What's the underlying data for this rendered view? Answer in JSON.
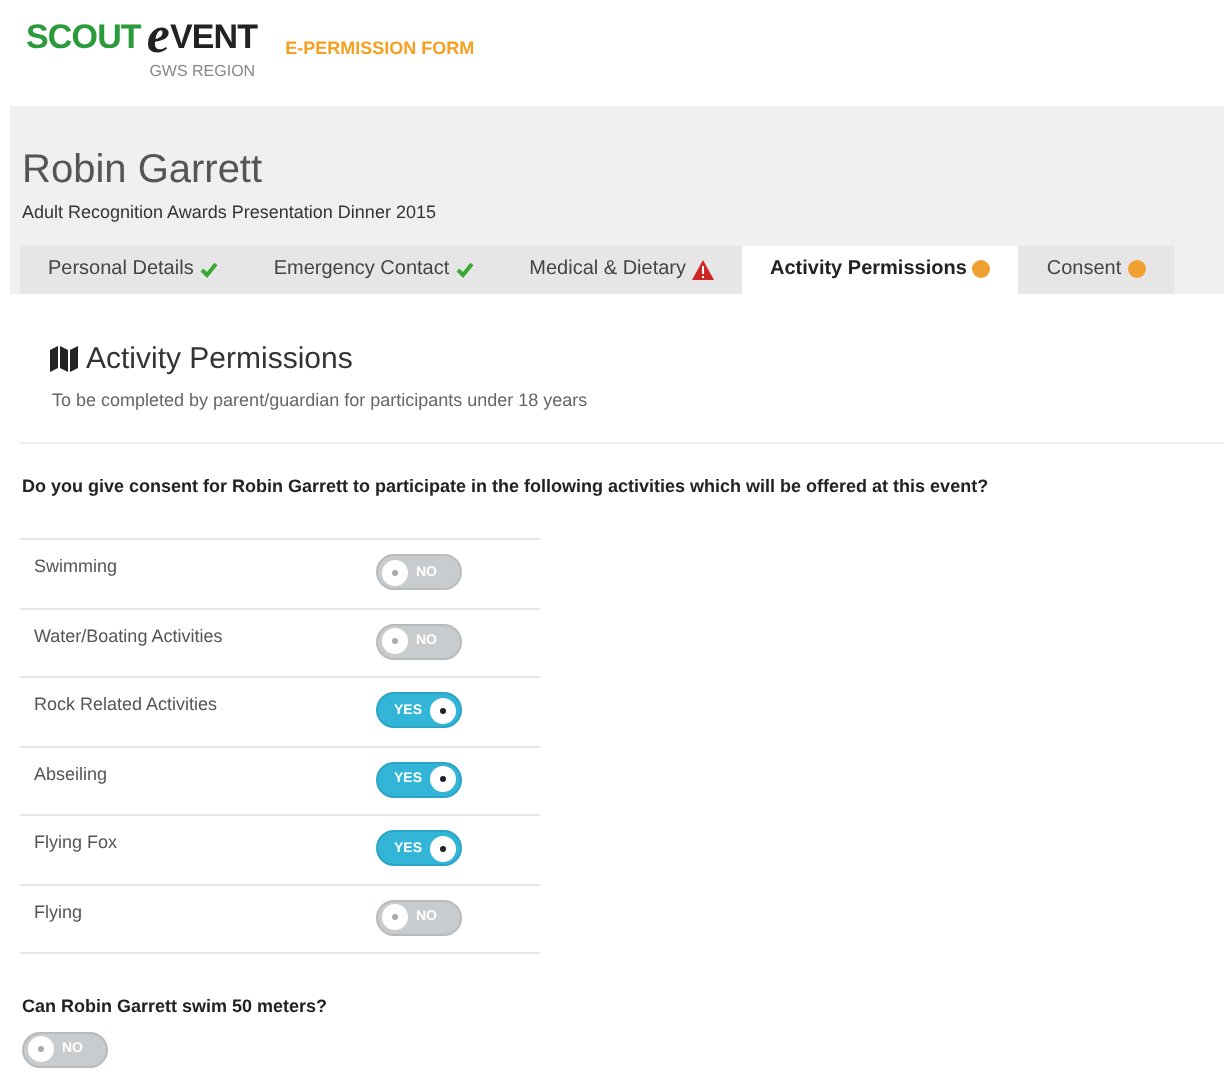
{
  "logo": {
    "parts": [
      "SCOUT",
      "e",
      "VENT"
    ],
    "region": "GWS REGION"
  },
  "form_title": "E-PERMISSION FORM",
  "header": {
    "name": "Robin Garrett",
    "event": "Adult Recognition Awards Presentation Dinner 2015"
  },
  "tabs": [
    {
      "label": "Personal Details",
      "kind": "complete",
      "selected": false
    },
    {
      "label": "Emergency Contact",
      "kind": "complete",
      "selected": false
    },
    {
      "label": "Medical & Dietary",
      "kind": "warning",
      "selected": false
    },
    {
      "label": "Activity Permissions",
      "kind": "pending",
      "selected": true
    },
    {
      "label": "Consent",
      "kind": "pending",
      "selected": false
    }
  ],
  "section": {
    "title": "Activity Permissions",
    "subtitle": "To be completed by parent/guardian for participants under 18 years"
  },
  "question": "Do you give consent for Robin Garrett to participate in the following activities which will be offered at this event?",
  "activities": [
    {
      "name": "Swimming",
      "on": false,
      "toggle_label": "NO"
    },
    {
      "name": "Water/Boating Activities",
      "on": false,
      "toggle_label": "NO"
    },
    {
      "name": "Rock Related Activities",
      "on": true,
      "toggle_label": "YES"
    },
    {
      "name": "Abseiling",
      "on": true,
      "toggle_label": "YES"
    },
    {
      "name": "Flying Fox",
      "on": true,
      "toggle_label": "YES"
    },
    {
      "name": "Flying",
      "on": false,
      "toggle_label": "NO"
    }
  ],
  "swim_question": {
    "label": "Can Robin Garrett swim 50 meters?",
    "on": false,
    "toggle_label": "NO"
  }
}
